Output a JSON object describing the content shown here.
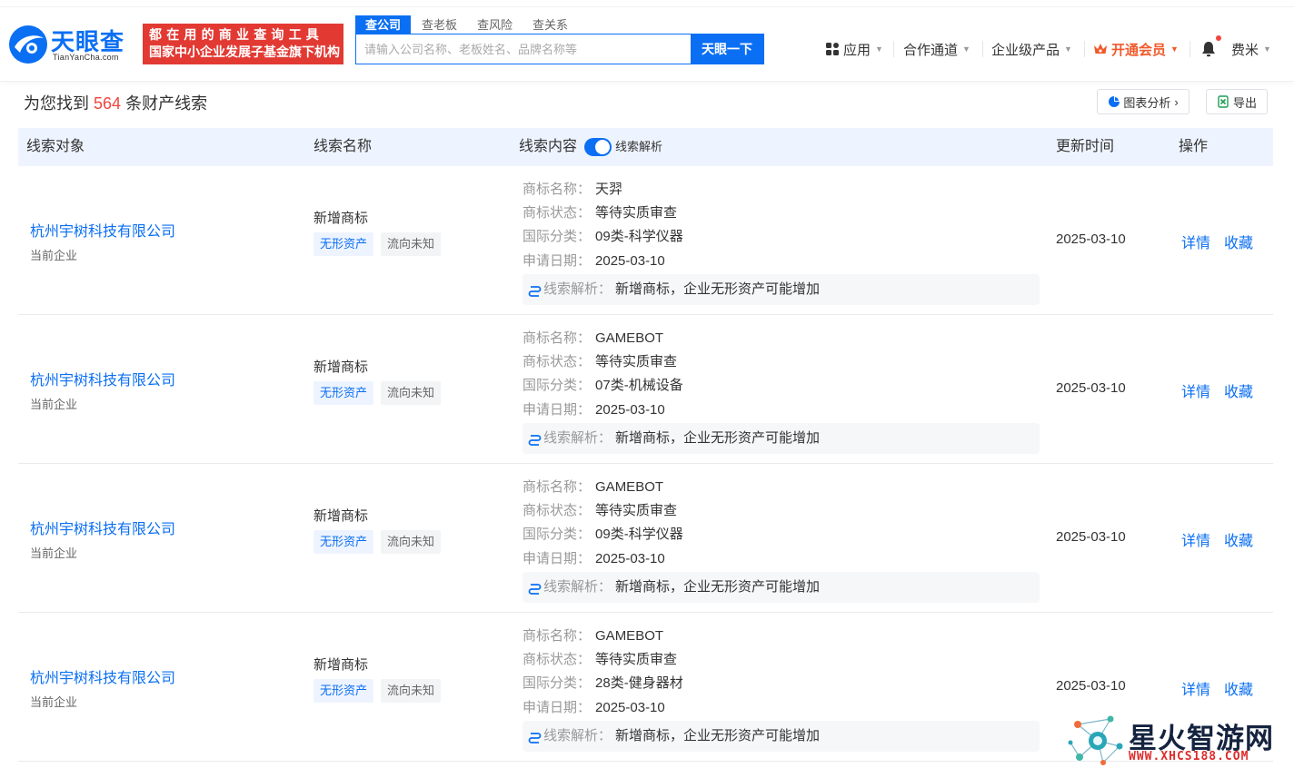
{
  "header": {
    "logo": {
      "name": "天眼查",
      "domain": "TianYanCha.com"
    },
    "slogan": {
      "line1": "都在用的商业查询工具",
      "line2": "国家中小企业发展子基金旗下机构"
    },
    "search": {
      "tabs": [
        "查公司",
        "查老板",
        "查风险",
        "查关系"
      ],
      "placeholder": "请输入公司名称、老板姓名、品牌名称等",
      "button": "天眼一下"
    },
    "nav": {
      "apps": "应用",
      "channel": "合作通道",
      "enterprise": "企业级产品",
      "vip": "开通会员",
      "user": "费米"
    }
  },
  "summary": {
    "prefix": "为您找到",
    "count": "564",
    "suffix": "条财产线索"
  },
  "actions": {
    "chart": "图表分析",
    "export": "导出"
  },
  "table": {
    "columns": {
      "target": "线索对象",
      "name": "线索名称",
      "content": "线索内容",
      "toggle": "线索解析",
      "updated": "更新时间",
      "ops": "操作"
    },
    "labels": {
      "brand": "商标名称：",
      "status": "商标状态：",
      "class": "国际分类：",
      "date": "申请日期：",
      "analysis": "线索解析："
    },
    "ops": {
      "detail": "详情",
      "favorite": "收藏"
    },
    "rows": [
      {
        "company": "杭州宇树科技有限公司",
        "company_sub": "当前企业",
        "clue": "新增商标",
        "tag1": "无形资产",
        "tag2": "流向未知",
        "brand": "天羿",
        "status": "等待实质审查",
        "class": "09类-科学仪器",
        "apply_date": "2025-03-10",
        "analysis": "新增商标，企业无形资产可能增加",
        "updated": "2025-03-10"
      },
      {
        "company": "杭州宇树科技有限公司",
        "company_sub": "当前企业",
        "clue": "新增商标",
        "tag1": "无形资产",
        "tag2": "流向未知",
        "brand": "GAMEBOT",
        "status": "等待实质审查",
        "class": "07类-机械设备",
        "apply_date": "2025-03-10",
        "analysis": "新增商标，企业无形资产可能增加",
        "updated": "2025-03-10"
      },
      {
        "company": "杭州宇树科技有限公司",
        "company_sub": "当前企业",
        "clue": "新增商标",
        "tag1": "无形资产",
        "tag2": "流向未知",
        "brand": "GAMEBOT",
        "status": "等待实质审查",
        "class": "09类-科学仪器",
        "apply_date": "2025-03-10",
        "analysis": "新增商标，企业无形资产可能增加",
        "updated": "2025-03-10"
      },
      {
        "company": "杭州宇树科技有限公司",
        "company_sub": "当前企业",
        "clue": "新增商标",
        "tag1": "无形资产",
        "tag2": "流向未知",
        "brand": "GAMEBOT",
        "status": "等待实质审查",
        "class": "28类-健身器材",
        "apply_date": "2025-03-10",
        "analysis": "新增商标，企业无形资产可能增加",
        "updated": "2025-03-10"
      }
    ]
  },
  "watermark": {
    "title": "星火智游网",
    "url": "WWW.XHCS188.COM"
  },
  "colors": {
    "brand_blue": "#0b6ff3",
    "accent_red": "#f0463c",
    "vip_orange": "#f0592a"
  }
}
